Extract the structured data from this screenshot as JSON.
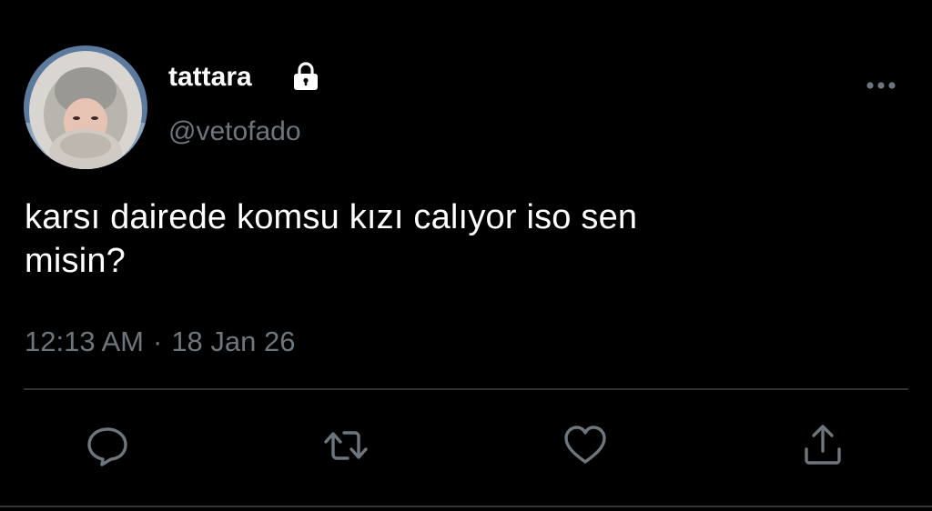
{
  "user": {
    "display_name": "tattara",
    "handle": "@vetofado",
    "protected": true
  },
  "tweet": {
    "text_line1": "karsı dairede komsu kızı calıyor iso sen",
    "text_line2": "misin?",
    "time": "12:13 AM",
    "separator": "·",
    "date": "18 Jan 26"
  },
  "icons": {
    "lock": "lock-icon",
    "more": "more-horizontal-icon",
    "reply": "reply-icon",
    "retweet": "retweet-icon",
    "like": "heart-icon",
    "share": "share-icon"
  },
  "colors": {
    "background": "#000000",
    "text": "#ffffff",
    "secondary_text": "#6e767d",
    "divider": "#2f3336"
  }
}
